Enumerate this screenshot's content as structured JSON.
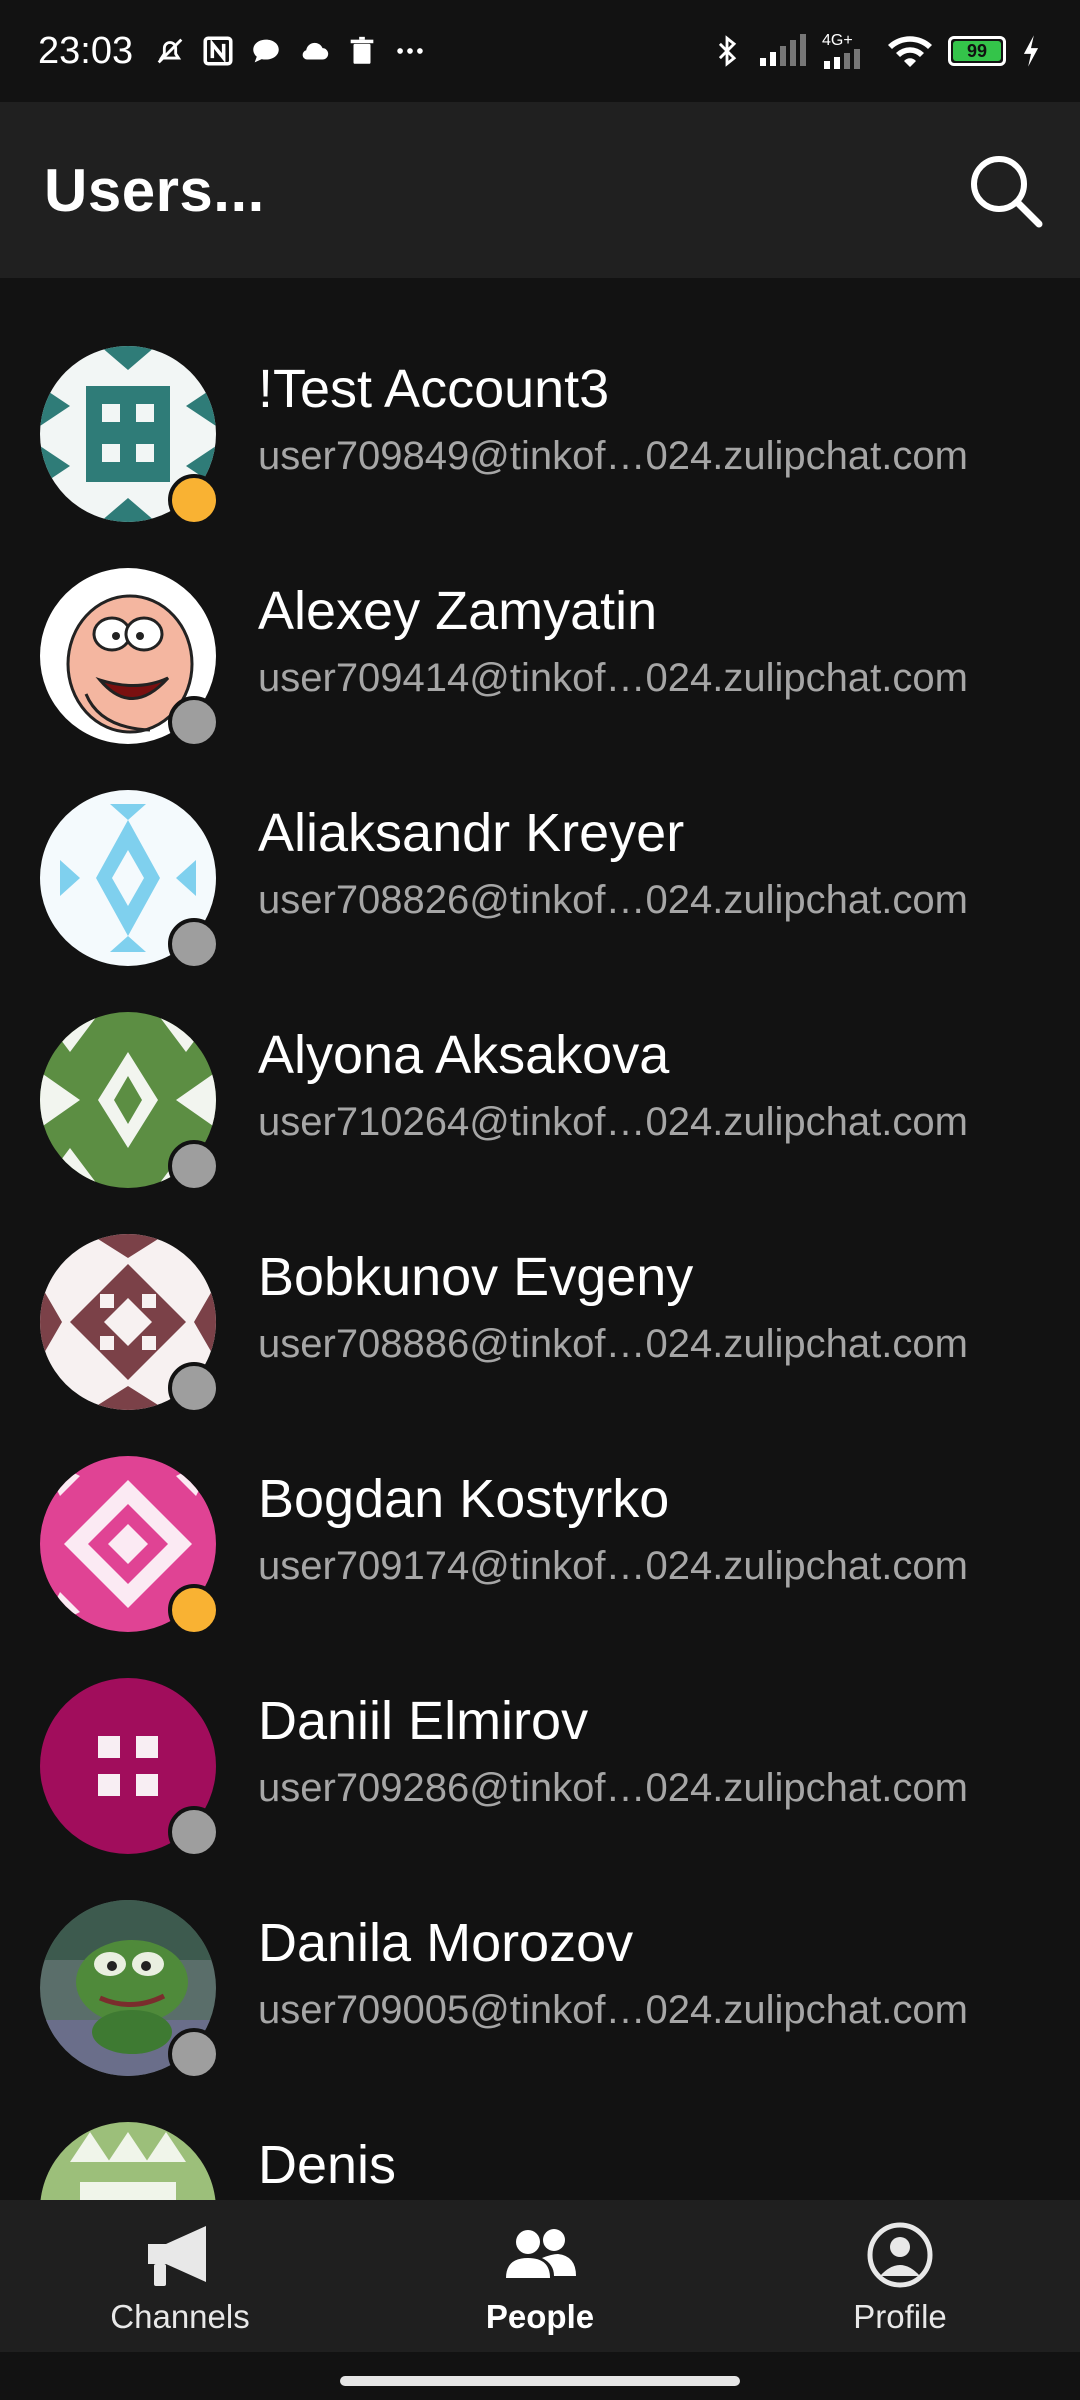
{
  "status_bar": {
    "time": "23:03",
    "network_label": "4G+",
    "battery": "99"
  },
  "app_bar": {
    "title": "Users..."
  },
  "users": [
    {
      "name": "!Test Account3",
      "email": "user709849@tinkof…024.zulipchat.com",
      "presence": "idle",
      "avatar": "teal-blocks"
    },
    {
      "name": "Alexey Zamyatin",
      "email": "user709414@tinkof…024.zulipchat.com",
      "presence": "offline",
      "avatar": "cartoon-face"
    },
    {
      "name": "Aliaksandr Kreyer",
      "email": "user708826@tinkof…024.zulipchat.com",
      "presence": "offline",
      "avatar": "light-blue-pattern"
    },
    {
      "name": "Alyona Aksakova",
      "email": "user710264@tinkof…024.zulipchat.com",
      "presence": "offline",
      "avatar": "green-pattern"
    },
    {
      "name": "Bobkunov Evgeny",
      "email": "user708886@tinkof…024.zulipchat.com",
      "presence": "offline",
      "avatar": "brown-pattern"
    },
    {
      "name": "Bogdan Kostyrko",
      "email": "user709174@tinkof…024.zulipchat.com",
      "presence": "idle",
      "avatar": "pink-pattern"
    },
    {
      "name": "Daniil Elmirov",
      "email": "user709286@tinkof…024.zulipchat.com",
      "presence": "offline",
      "avatar": "magenta-blocks"
    },
    {
      "name": "Danila Morozov",
      "email": "user709005@tinkof…024.zulipchat.com",
      "presence": "offline",
      "avatar": "frog-photo"
    },
    {
      "name": "Denis",
      "email": "",
      "presence": "offline",
      "avatar": "light-green-pattern"
    }
  ],
  "bottom_nav": {
    "items": [
      {
        "label": "Channels",
        "icon": "megaphone-icon",
        "active": false
      },
      {
        "label": "People",
        "icon": "people-icon",
        "active": true
      },
      {
        "label": "Profile",
        "icon": "profile-icon",
        "active": false
      }
    ]
  },
  "colors": {
    "background": "#121212",
    "app_bar": "#202020",
    "presence_idle": "#f9b233",
    "presence_offline": "#9e9e9e",
    "email_text": "#a6a6a6"
  }
}
